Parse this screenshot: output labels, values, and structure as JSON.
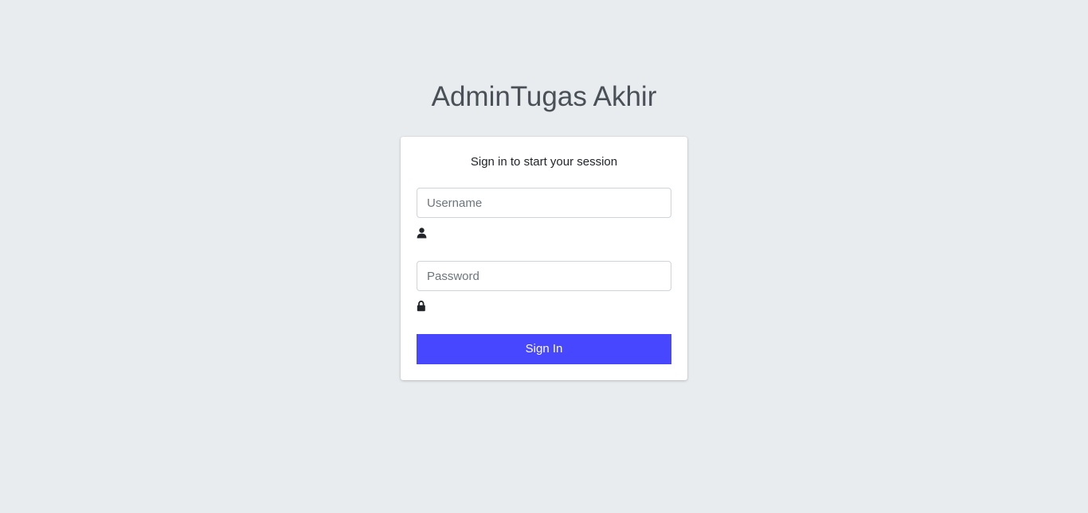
{
  "logo": {
    "strong": "Admin",
    "light": "Tugas Akhir"
  },
  "card": {
    "message": "Sign in to start your session"
  },
  "form": {
    "username": {
      "placeholder": "Username",
      "value": "",
      "icon": "user-icon"
    },
    "password": {
      "placeholder": "Password",
      "value": "",
      "icon": "lock-icon"
    },
    "submit_label": "Sign In"
  },
  "colors": {
    "background": "#e9ecef",
    "primary": "#4747ff",
    "card": "#ffffff",
    "icon": "#212529"
  }
}
